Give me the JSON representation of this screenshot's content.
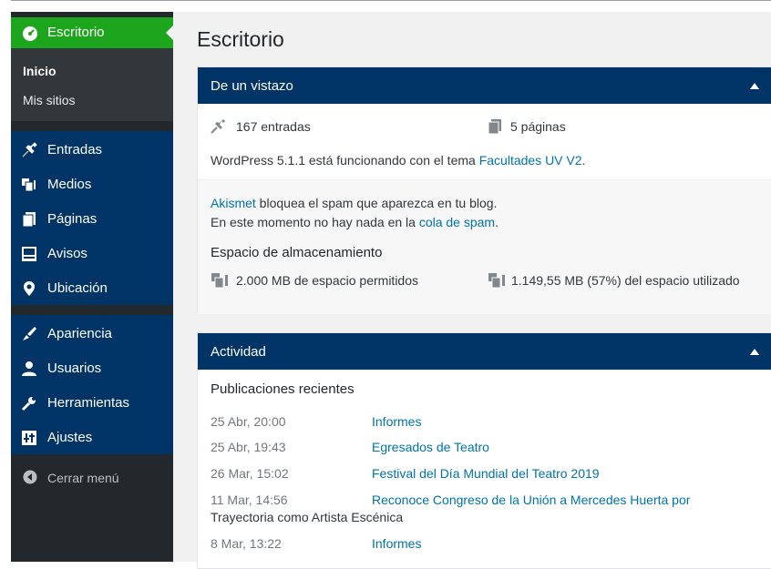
{
  "sidebar": {
    "current": {
      "label": "Escritorio",
      "icon": "dashboard-icon"
    },
    "submenu": [
      {
        "label": "Inicio"
      },
      {
        "label": "Mis sitios"
      }
    ],
    "group1": [
      {
        "label": "Entradas",
        "icon": "pin-icon"
      },
      {
        "label": "Medios",
        "icon": "media-icon"
      },
      {
        "label": "Páginas",
        "icon": "pages-icon"
      },
      {
        "label": "Avisos",
        "icon": "notices-icon"
      },
      {
        "label": "Ubicación",
        "icon": "location-icon"
      }
    ],
    "group2": [
      {
        "label": "Apariencia",
        "icon": "brush-icon"
      },
      {
        "label": "Usuarios",
        "icon": "users-icon"
      },
      {
        "label": "Herramientas",
        "icon": "wrench-icon"
      },
      {
        "label": "Ajustes",
        "icon": "settings-icon"
      }
    ],
    "collapse_label": "Cerrar menú",
    "colors": {
      "active": "#1ea51e",
      "group": "#003366",
      "base": "#23282d"
    }
  },
  "main": {
    "title": "Escritorio",
    "glance": {
      "header": "De un vistazo",
      "posts": "167 entradas",
      "pages": "5 páginas",
      "version_prefix": "WordPress 5.1.1 está funcionando con el tema ",
      "theme_link": "Facultades UV V2",
      "version_suffix": ".",
      "akismet_link": "Akismet",
      "akismet_text": " bloquea el spam que aparezca en tu blog.",
      "spam_prefix": "En este momento no hay nada en la ",
      "spam_link": "cola de spam",
      "spam_suffix": ".",
      "storage_title": "Espacio de almacenamiento",
      "storage_allowed": "2.000 MB de espacio permitidos",
      "storage_used": "1.149,55 MB (57%) del espacio utilizado"
    },
    "activity": {
      "header": "Actividad",
      "subtitle": "Publicaciones recientes",
      "items": [
        {
          "date": "25 Abr, 20:00",
          "title": "Informes"
        },
        {
          "date": "25 Abr, 19:43",
          "title": "Egresados de Teatro"
        },
        {
          "date": "26 Mar, 15:02",
          "title": "Festival del Día Mundial del Teatro 2019"
        },
        {
          "date": "11 Mar, 14:56",
          "title": "Reconoce Congreso de la Unión a Mercedes Huerta por",
          "title2": "Trayectoria como Artista Escénica"
        },
        {
          "date": "8 Mar, 13:22",
          "title": "Informes"
        }
      ]
    }
  }
}
